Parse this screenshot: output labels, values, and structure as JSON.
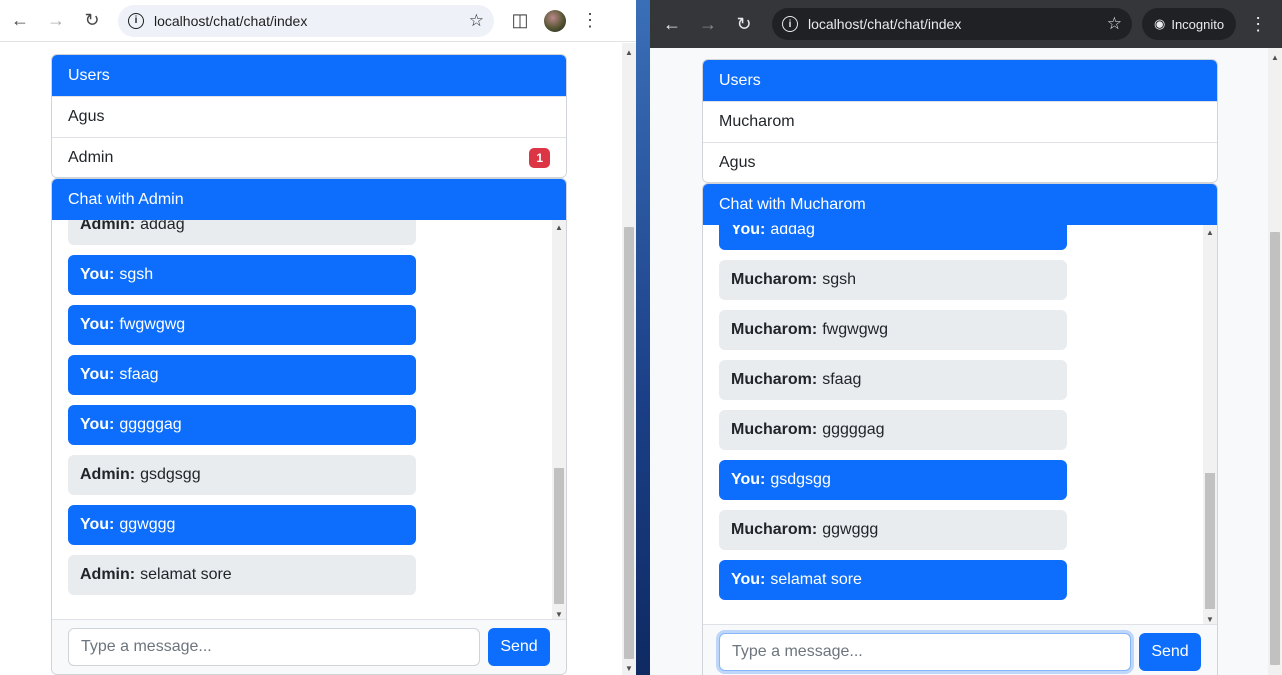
{
  "left": {
    "url": "localhost/chat/chat/index",
    "users_title": "Users",
    "users": [
      {
        "name": "Agus",
        "badge": ""
      },
      {
        "name": "Admin",
        "badge": "1"
      }
    ],
    "chat_title": "Chat with Admin",
    "messages": [
      {
        "sender": "Admin:",
        "text": "addag",
        "mine": false
      },
      {
        "sender": "You:",
        "text": "sgsh",
        "mine": true
      },
      {
        "sender": "You:",
        "text": "fwgwgwg",
        "mine": true
      },
      {
        "sender": "You:",
        "text": "sfaag",
        "mine": true
      },
      {
        "sender": "You:",
        "text": "gggggag",
        "mine": true
      },
      {
        "sender": "Admin:",
        "text": "gsdgsgg",
        "mine": false
      },
      {
        "sender": "You:",
        "text": "ggwggg",
        "mine": true
      },
      {
        "sender": "Admin:",
        "text": "selamat sore",
        "mine": false
      }
    ],
    "input_placeholder": "Type a message...",
    "send_label": "Send"
  },
  "right": {
    "url": "localhost/chat/chat/index",
    "incognito_label": "Incognito",
    "users_title": "Users",
    "users": [
      {
        "name": "Mucharom",
        "badge": ""
      },
      {
        "name": "Agus",
        "badge": ""
      }
    ],
    "chat_title": "Chat with Mucharom",
    "messages": [
      {
        "sender": "You:",
        "text": "addag",
        "mine": true
      },
      {
        "sender": "Mucharom:",
        "text": "sgsh",
        "mine": false
      },
      {
        "sender": "Mucharom:",
        "text": "fwgwgwg",
        "mine": false
      },
      {
        "sender": "Mucharom:",
        "text": "sfaag",
        "mine": false
      },
      {
        "sender": "Mucharom:",
        "text": "gggggag",
        "mine": false
      },
      {
        "sender": "You:",
        "text": "gsdgsgg",
        "mine": true
      },
      {
        "sender": "Mucharom:",
        "text": "ggwggg",
        "mine": false
      },
      {
        "sender": "You:",
        "text": "selamat sore",
        "mine": true
      }
    ],
    "input_placeholder": "Type a message...",
    "send_label": "Send"
  },
  "colors": {
    "primary": "#0d6efd",
    "danger": "#dc3545",
    "bubble_other": "#e9ecef"
  }
}
